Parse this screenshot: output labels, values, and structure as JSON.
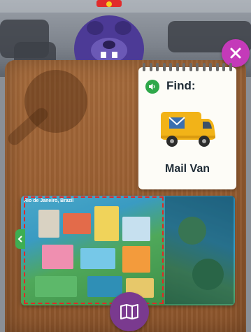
{
  "find_card": {
    "heading": "Find:",
    "item_name": "Mail Van",
    "item_icon": "mail-van-icon"
  },
  "map": {
    "title": "Rio de Janeiro, Brazil"
  },
  "buttons": {
    "close_icon": "close-icon",
    "audio_icon": "speaker-icon",
    "map_book_icon": "book-map-icon"
  },
  "colors": {
    "close_button": "#c43ab9",
    "audio_button": "#2fa84a",
    "map_book_button": "#7a3a8f",
    "selection_border": "#e02828",
    "van_body": "#f2b318"
  }
}
